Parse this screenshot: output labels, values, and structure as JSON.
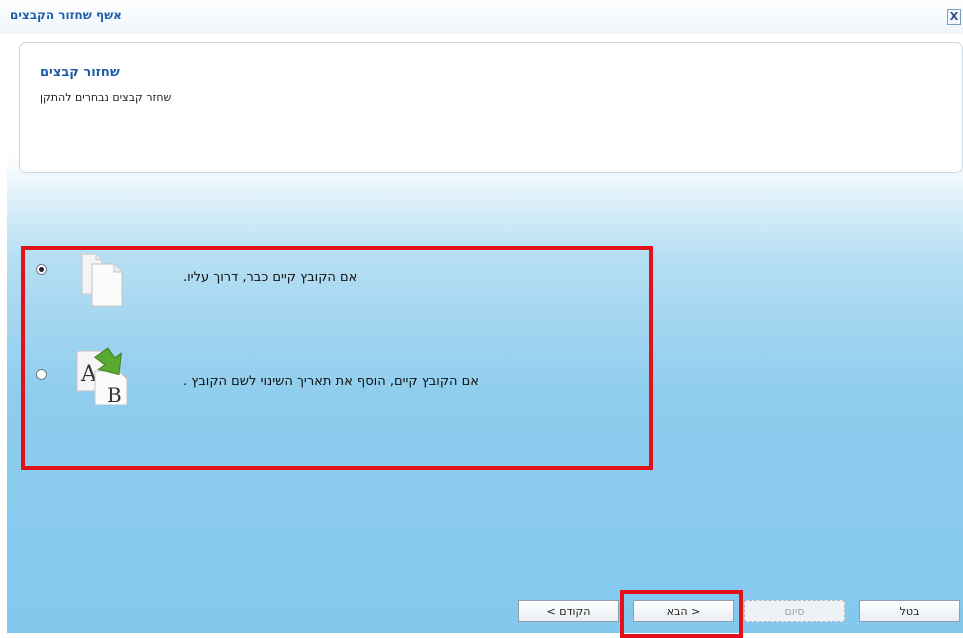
{
  "window": {
    "title": "אשף שחזור הקבצים",
    "close_label": "X"
  },
  "header": {
    "title": "שחזור קבצים",
    "subtitle": "שחזר קבצים נבחרים להתקן"
  },
  "options": [
    {
      "label": "אם הקובץ קיים כבר, דרוך עליו.",
      "selected": true,
      "icon": "file-overwrite-icon"
    },
    {
      "label": "אם הקובץ קיים, הוסף את תאריך השינוי לשם הקובץ .",
      "selected": false,
      "icon": "file-rename-icon"
    }
  ],
  "buttons": {
    "back": "הקודם >",
    "next": "< הבא",
    "finish": "סיום",
    "cancel": "בטל"
  },
  "colors": {
    "highlight": "#e2121b",
    "title_blue": "#1e5aa6",
    "arrow_green": "#5aa832"
  }
}
